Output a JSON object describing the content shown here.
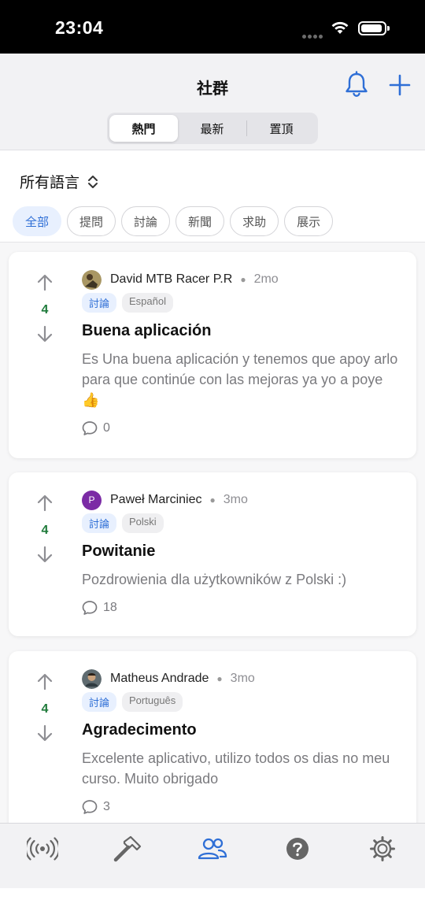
{
  "status_bar": {
    "time": "23:04"
  },
  "nav": {
    "title": "社群",
    "segments": [
      "熱門",
      "最新",
      "置頂"
    ],
    "active_segment": "熱門"
  },
  "language_filter": {
    "label": "所有語言"
  },
  "chips": [
    "全部",
    "提問",
    "討論",
    "新聞",
    "求助",
    "展示"
  ],
  "posts": [
    {
      "author": "David MTB Racer P.R",
      "age": "2mo",
      "votes": "4",
      "category": "討論",
      "language": "Español",
      "title": "Buena aplicación",
      "excerpt": "Es Una buena aplicación y tenemos que apoy arlo para que continúe con las mejoras ya yo a poye 👍",
      "comments": "0",
      "avatar": "photo"
    },
    {
      "author": "Paweł Marciniec",
      "age": "3mo",
      "votes": "4",
      "category": "討論",
      "language": "Polski",
      "title": "Powitanie",
      "excerpt": "Pozdrowienia dla użytkowników z Polski :)",
      "comments": "18",
      "avatar": "P",
      "avatar_color": "#7b2ba5"
    },
    {
      "author": "Matheus Andrade",
      "age": "3mo",
      "votes": "4",
      "category": "討論",
      "language": "Português",
      "title": "Agradecimento",
      "excerpt": "Excelente aplicativo, utilizo todos os dias no meu curso. Muito obrigado",
      "comments": "3",
      "avatar": "photo"
    }
  ],
  "tab_bar": {
    "items": [
      "broadcast-icon",
      "hammer-icon",
      "community-icon",
      "help-icon",
      "settings-icon"
    ],
    "active": "community-icon"
  },
  "colors": {
    "accent": "#2f6fd6",
    "vote": "#1e7a3a"
  }
}
